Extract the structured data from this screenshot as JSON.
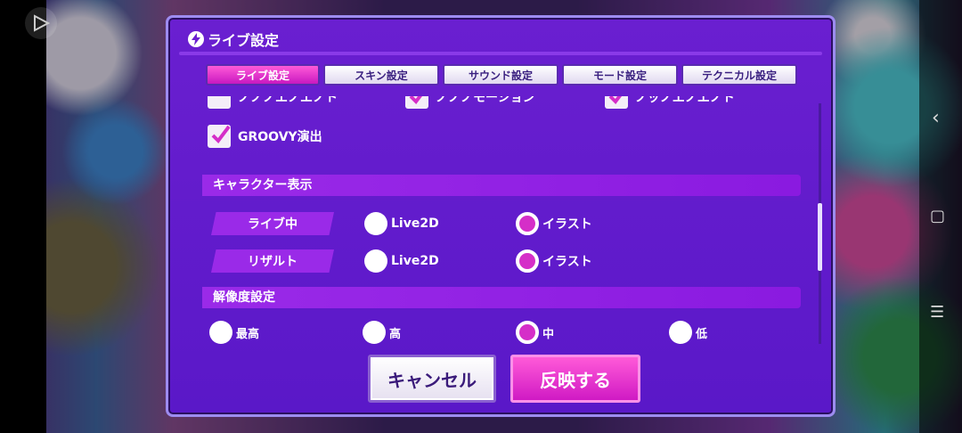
{
  "dialog": {
    "title": "ライブ設定",
    "tabs": [
      "ライブ設定",
      "スキン設定",
      "サウンド設定",
      "モード設定",
      "テクニカル設定"
    ],
    "active_tab": 0,
    "partial_checkboxes": [
      {
        "label": "ノノノエノエノト",
        "checked": false
      },
      {
        "label": "ノノノモーション",
        "checked": true
      },
      {
        "label": "ノッノエノエノト",
        "checked": true
      }
    ],
    "groovy": {
      "label": "GROOVY演出",
      "checked": true
    },
    "character_section": {
      "title": "キャラクター表示",
      "rows": [
        {
          "label": "ライブ中",
          "options": [
            "Live2D",
            "イラスト"
          ],
          "selected": 1
        },
        {
          "label": "リザルト",
          "options": [
            "Live2D",
            "イラスト"
          ],
          "selected": 1
        }
      ]
    },
    "resolution_section": {
      "title": "解像度設定",
      "options": [
        "最高",
        "高",
        "中",
        "低"
      ],
      "selected": 2
    },
    "buttons": {
      "cancel": "キャンセル",
      "ok": "反映する"
    }
  },
  "colors": {
    "accent": "#9a2ae8",
    "active": "#d52ec8",
    "panel": "#5a18c8"
  }
}
